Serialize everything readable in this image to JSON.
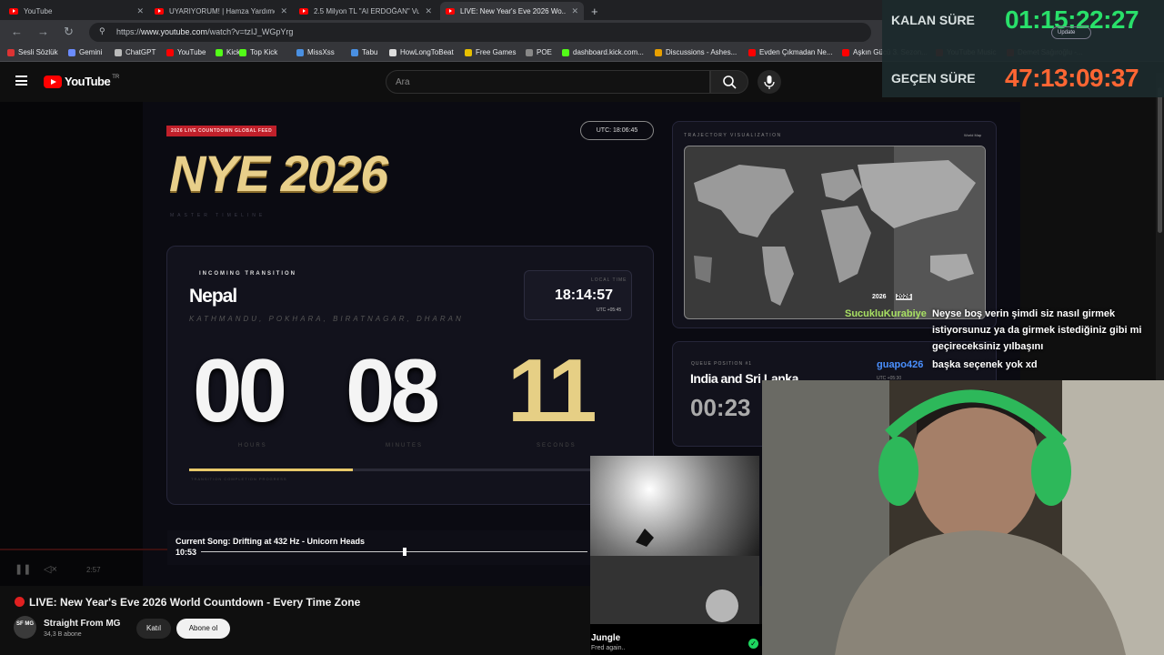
{
  "tabs": [
    {
      "label": "YouTube"
    },
    {
      "label": "UYARIYORUM! | Hamza Yardımcı..."
    },
    {
      "label": "2.5 Milyon TL \"AI ERDOĞAN\" Vu..."
    },
    {
      "label": "LIVE: New Year's Eve 2026 Wo..."
    }
  ],
  "address": {
    "prefix": "https://",
    "host": "www.youtube.com",
    "path": "/watch?v=tzIJ_WGpYrg"
  },
  "bookmarks": [
    {
      "label": "Sesli Sözlük",
      "color": "#d33"
    },
    {
      "label": "Gemini",
      "color": "#6b8cff"
    },
    {
      "label": "ChatGPT",
      "color": "#bbb"
    },
    {
      "label": "YouTube",
      "color": "#f00"
    },
    {
      "label": "Kick",
      "color": "#53fc18"
    },
    {
      "label": "Top Kick",
      "color": "#53fc18"
    },
    {
      "label": "MissXss",
      "color": "#4a90e2"
    },
    {
      "label": "Tabu",
      "color": "#4a90e2"
    },
    {
      "label": "HowLongToBeat",
      "color": "#ddd"
    },
    {
      "label": "Free Games",
      "color": "#e8c000"
    },
    {
      "label": "POE",
      "color": "#888"
    },
    {
      "label": "dashboard.kick.com...",
      "color": "#53fc18"
    },
    {
      "label": "Discussions - Ashes...",
      "color": "#e8a000"
    },
    {
      "label": "Evden Çıkmadan Ne...",
      "color": "#f00"
    },
    {
      "label": "Aşkın Gücü 3. Sezon...",
      "color": "#f00"
    },
    {
      "label": "YouTube Music",
      "color": "#f00"
    },
    {
      "label": "Demet Sağıroğlu -...",
      "color": "#f00"
    }
  ],
  "yt": {
    "logo": "YouTube",
    "region": "TR",
    "search_placeholder": "Ara"
  },
  "feed": {
    "badge": "2026 LIVE COUNTDOWN GLOBAL FEED",
    "title": "NYE 2026",
    "subtitle": "MASTER TIMELINE",
    "utc": "UTC: 18:06:45",
    "incoming_label": "INCOMING TRANSITION",
    "country": "Nepal",
    "cities": "KATHMANDU, POKHARA, BIRATNAGAR, DHARAN",
    "local_time_label": "LOCAL TIME",
    "local_time": "18:14:57",
    "local_utc": "UTC +05:45",
    "hours": "00",
    "minutes": "08",
    "seconds": "11",
    "hours_label": "HOURS",
    "minutes_label": "MINUTES",
    "seconds_label": "SECONDS",
    "progress": 0.37,
    "progress_label": "TRANSITION COMPLETION PROGRESS",
    "traj_label": "TRAJECTORY VISUALIZATION",
    "world_label": "World Map",
    "year_old": "2026",
    "year_new": "2026",
    "queue_label": "QUEUE POSITION #1",
    "queue_name": "India and Sri Lanka",
    "queue_time": "00:23",
    "queue_utc": "UTC +05:30"
  },
  "song": {
    "title": "Current Song: Drifting at 432 Hz - Unicorn Heads",
    "time": "10:53",
    "progress": 0.52
  },
  "player_time": "2:57",
  "video": {
    "title": "LIVE: New Year's Eve 2026 World Countdown - Every Time Zone"
  },
  "channel": {
    "avatar": "SF MG",
    "name": "Straight From MG",
    "subs": "34,3 B abone",
    "join": "Katıl",
    "subscribe": "Abone ol"
  },
  "overlay": {
    "remaining_label": "KALAN SÜRE",
    "remaining": "01:15:22:27",
    "elapsed_label": "GEÇEN SÜRE",
    "elapsed": "47:13:09:37",
    "update": "Update"
  },
  "chat": [
    {
      "user": "SucukluKurabiye",
      "color": "#a8e063",
      "lines": [
        "Neyse boş verin şimdi siz nasıl girmek",
        "istiyorsunuz ya da girmek istediğiniz gibi mi",
        "geçireceksiniz yılbaşını"
      ]
    },
    {
      "user": "guapo426",
      "color": "#4a90ff",
      "lines": [
        "başka seçenek yok xd"
      ]
    }
  ],
  "album": {
    "title": "Jungle",
    "subtitle": "Fred again.."
  }
}
